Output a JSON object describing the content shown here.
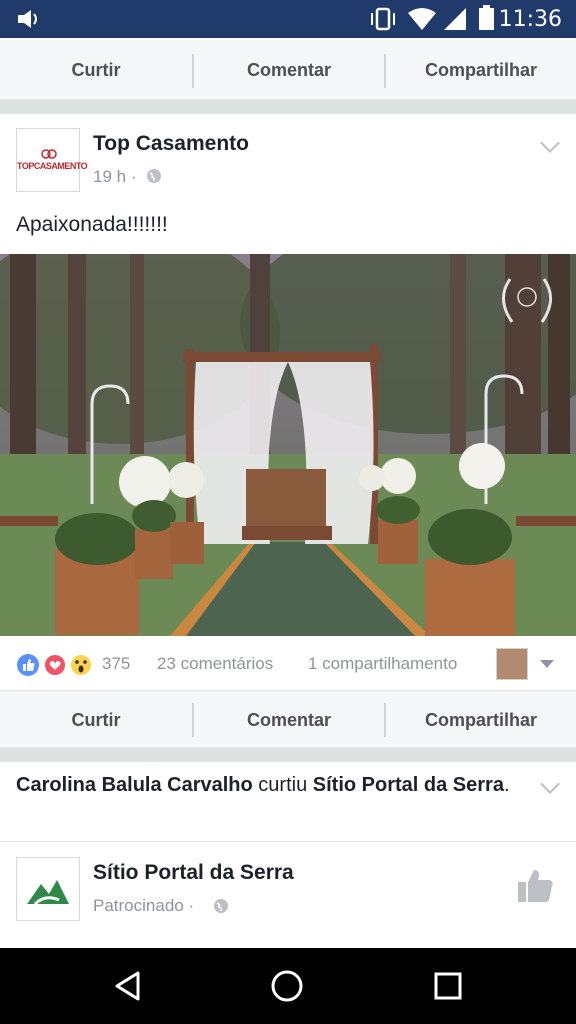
{
  "status_bar": {
    "time": "11:36"
  },
  "top_actions": {
    "like": "Curtir",
    "comment": "Comentar",
    "share": "Compartilhar"
  },
  "post": {
    "page_name": "Top Casamento",
    "logo_text": "TOPCASAMENTO",
    "time": "19 h",
    "separator": "·",
    "text": "Apaixonada!!!!!!!",
    "reaction_count": "375",
    "comments": "23 comentários",
    "shares": "1 compartilhamento"
  },
  "post_actions": {
    "like": "Curtir",
    "comment": "Comentar",
    "share": "Compartilhar"
  },
  "activity": {
    "user": "Carolina Balula Carvalho",
    "verb": " curtiu ",
    "page": "Sítio Portal da Serra",
    "end": "."
  },
  "sponsored": {
    "page_name": "Sítio Portal da Serra",
    "label": "Patrocinado",
    "separator": "·"
  },
  "colors": {
    "status_bar": "#1f3a6b",
    "like_blue": "#5890ff",
    "love_red": "#f25268",
    "wow_yellow": "#fcd34d"
  }
}
